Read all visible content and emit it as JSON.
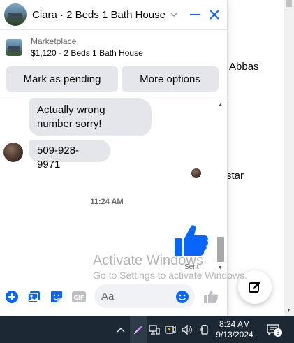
{
  "background": {
    "name_1": "Abbas",
    "name_2": "star"
  },
  "chat": {
    "title": "Ciara · 2 Beds 1 Bath House",
    "listing": {
      "source": "Marketplace",
      "price_title": "$1,120 - 2 Beds 1 Bath House"
    },
    "actions": {
      "pending": "Mark as pending",
      "more": "More options"
    },
    "messages": [
      {
        "text": "Actually wrong number sorry!"
      },
      {
        "text": "509-928-9971"
      }
    ],
    "timestamp": "11:24 AM",
    "status": "Sent",
    "composer": {
      "placeholder": "Aa"
    }
  },
  "watermark": {
    "line1": "Activate Windows",
    "line2": "Go to Settings to activate Windows."
  },
  "taskbar": {
    "time": "8:24 AM",
    "date": "9/13/2024",
    "notification_count": "5"
  },
  "colors": {
    "accent": "#0866ff",
    "bubble": "#e4e6eb",
    "taskbar": "#1c2833"
  }
}
